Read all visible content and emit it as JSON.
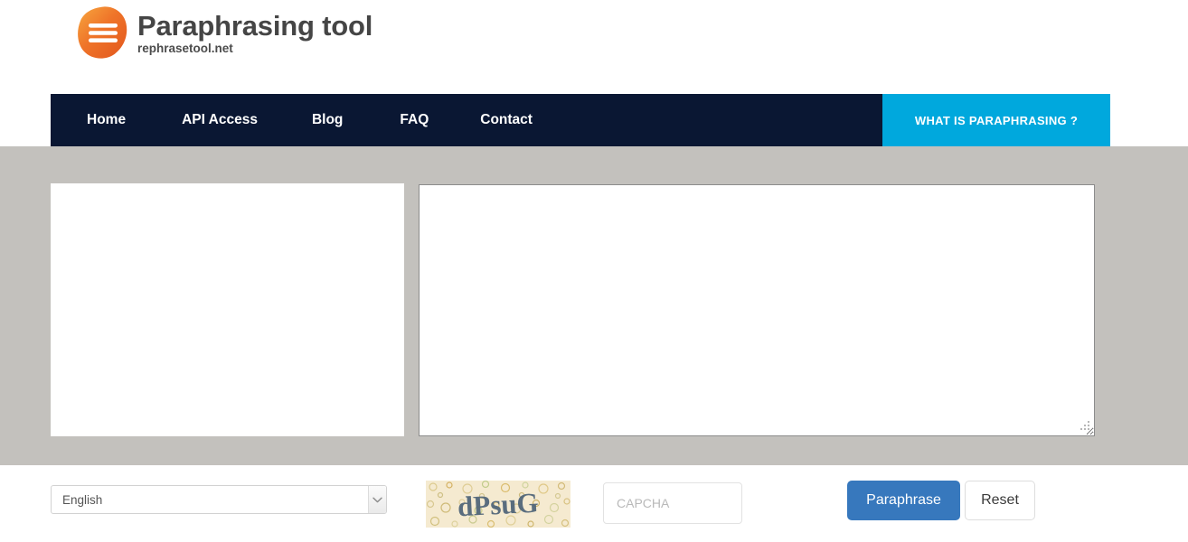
{
  "brand": {
    "title": "Paraphrasing tool",
    "subtitle": "rephrasetool.net",
    "logo_icon": "hamburger-blob-logo-icon",
    "logo_colors": {
      "orange_light": "#f59b3c",
      "orange_mid": "#ee6a2a",
      "orange_dark": "#e05a21"
    }
  },
  "nav": {
    "background": "#0a1733",
    "items": [
      {
        "label": "Home"
      },
      {
        "label": "API Access"
      },
      {
        "label": "Blog"
      },
      {
        "label": "FAQ"
      },
      {
        "label": "Contact"
      }
    ],
    "cta": {
      "label": "WHAT IS PARAPHRASING ?",
      "background": "#00a8dd"
    }
  },
  "workspace": {
    "background": "#c3c1bd",
    "input": {
      "value": "",
      "placeholder": ""
    },
    "output": {
      "value": "",
      "placeholder": ""
    },
    "resize_handle_icon": "resize-grip-icon"
  },
  "controls": {
    "language": {
      "selected": "English",
      "options": [
        "English"
      ],
      "chevron_icon": "chevron-down-icon"
    },
    "captcha": {
      "image_text": "dPsuG",
      "image_alt": "captcha-image",
      "input_value": "",
      "input_placeholder": "CAPCHA"
    },
    "buttons": {
      "primary": {
        "label": "Paraphrase",
        "color": "#3778bd"
      },
      "secondary": {
        "label": "Reset",
        "color": "#ffffff"
      }
    }
  }
}
